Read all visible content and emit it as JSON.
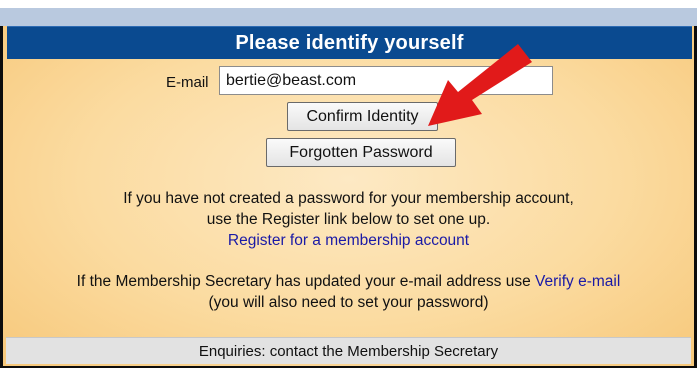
{
  "header": {
    "title": "Please identify yourself"
  },
  "form": {
    "email_label": "E-mail",
    "email_value": "bertie@beast.com",
    "confirm_button": "Confirm Identity",
    "forgot_button": "Forgotten Password"
  },
  "info": {
    "line1": "If you have not created a password for your membership account,",
    "line2": "use the Register link below to set one up.",
    "register_link": "Register for a membership account"
  },
  "verify": {
    "text": "If the Membership Secretary has updated your e-mail address use",
    "link": "Verify e-mail",
    "note": "(you will also need to set your password)"
  },
  "footer": {
    "text": "Enquiries: contact the Membership Secretary"
  },
  "colors": {
    "header_bg": "#0a4a90",
    "panel_bg": "#fbdba0",
    "link": "#1a1aa6",
    "arrow": "#e11a1a"
  },
  "icons": {
    "pointer": "red-arrow-icon"
  }
}
